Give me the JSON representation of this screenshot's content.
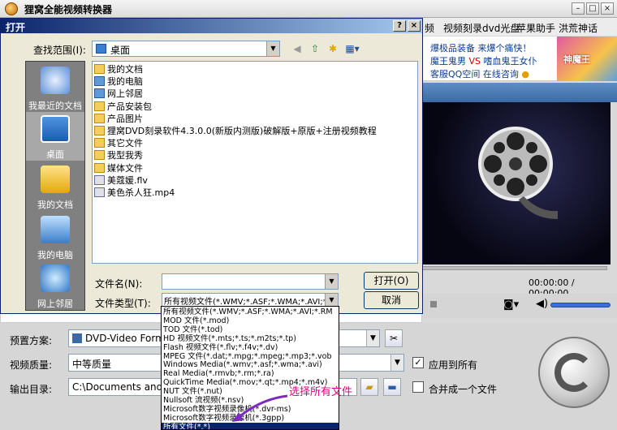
{
  "app": {
    "title": "狸窝全能视频转换器",
    "menu": [
      "频",
      "视频刻录dvd光盘",
      "苹果助手",
      "洪荒神话"
    ]
  },
  "banner": {
    "line1_a": "爆极品装备",
    "line1_b": "来爆个痛快！",
    "line2_a": "魔王鬼男",
    "line2_vs": "VS",
    "line2_b": "嗜血鬼王女仆",
    "line3_a": "客服QQ空间",
    "line3_b": "在线咨询",
    "ad_text": "神魔王"
  },
  "player": {
    "time": "00:00:00 / 00:00:00"
  },
  "dialog": {
    "title": "打开",
    "lookin_label": "查找范围(I):",
    "lookin_value": "桌面",
    "places": [
      {
        "label": "我最近的文档"
      },
      {
        "label": "桌面"
      },
      {
        "label": "我的文档"
      },
      {
        "label": "我的电脑"
      },
      {
        "label": "网上邻居"
      }
    ],
    "files": [
      {
        "name": "我的文档",
        "icon": "folder"
      },
      {
        "name": "我的电脑",
        "icon": "sys"
      },
      {
        "name": "网上邻居",
        "icon": "sys"
      },
      {
        "name": "产品安装包",
        "icon": "folder"
      },
      {
        "name": "产品图片",
        "icon": "folder"
      },
      {
        "name": "狸窝DVD刻录软件4.3.0.0(新版内测版)破解版+原版+注册视频教程",
        "icon": "folder"
      },
      {
        "name": "其它文件",
        "icon": "folder"
      },
      {
        "name": "我型我秀",
        "icon": "folder"
      },
      {
        "name": "媒体文件",
        "icon": "folder"
      },
      {
        "name": "美蔻媛.flv",
        "icon": "vid"
      },
      {
        "name": "美色杀人狂.mp4",
        "icon": "vid"
      }
    ],
    "filename_label": "文件名(N):",
    "filename_value": "",
    "filetype_label": "文件类型(T):",
    "filetype_value": "所有视频文件(*.WMV;*.ASF;*.WMA;*.AVI;*.RM",
    "open_button": "打开(O)",
    "cancel_button": "取消",
    "filetype_options": [
      "所有视频文件(*.WMV;*.ASF;*.WMA;*.AVI;*.RM",
      "MOD 文件(*.mod)",
      "TOD 文件(*.tod)",
      "HD 视频文件(*.mts;*.ts;*.m2ts;*.tp)",
      "Flash 视频文件(*.flv;*.f4v;*.dv)",
      "MPEG 文件(*.dat;*.mpg;*.mpeg;*.mp3;*.vob",
      "Windows Media(*.wmv;*.asf;*.wma;*.avi)",
      "Real Media(*.rmvb;*.rm;*.ra)",
      "QuickTime Media(*.mov;*.qt;*.mp4;*.m4v)",
      "NUT 文件(*.nut)",
      "Nullsoft 流视频(*.nsv)",
      "Microsoft数字视频录像机(*.dvr-ms)",
      "Microsoft数字视频录像机(*.3gpp)",
      "所有文件(*.*)"
    ],
    "selected_option_index": 13
  },
  "annotation": "选择所有文件",
  "settings": {
    "preset_label": "预置方案:",
    "preset_value": "DVD-Video Format",
    "quality_label": "视频质量:",
    "quality_value": "中等质量",
    "apply_all_label": "应用到所有",
    "apply_all_checked": true,
    "output_label": "输出目录:",
    "output_value": "C:\\Documents and Se",
    "merge_label": "合并成一个文件",
    "merge_checked": false
  }
}
